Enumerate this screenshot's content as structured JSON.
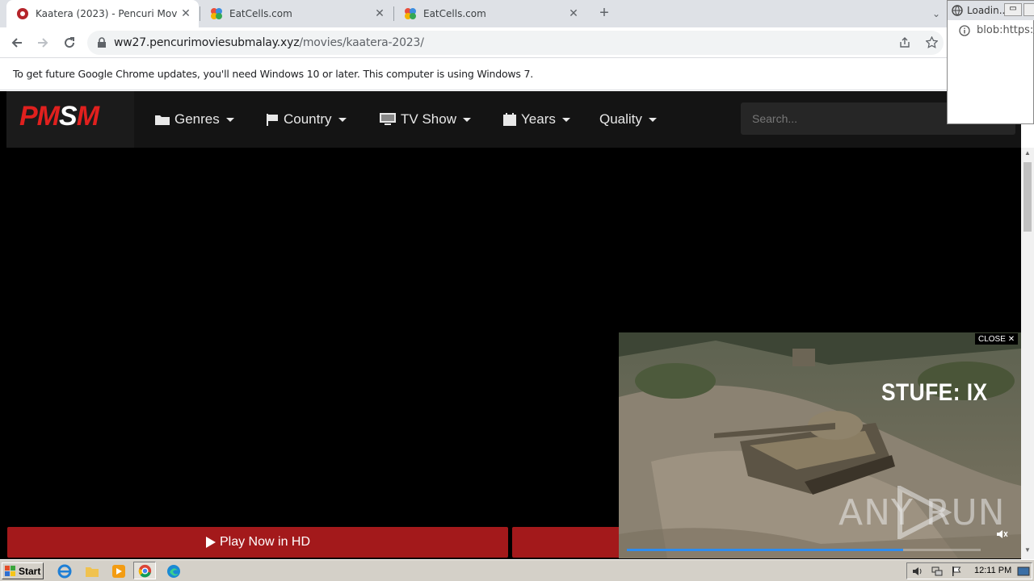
{
  "browser": {
    "tabs": [
      {
        "title": "Kaatera (2023) - Pencuri Movie Subl",
        "active": true
      },
      {
        "title": "EatCells.com",
        "active": false
      },
      {
        "title": "EatCells.com",
        "active": false
      }
    ],
    "new_tab_symbol": "+",
    "url_host": "ww27.pencurimoviesubmalay.xyz",
    "url_path": "/movies/kaatera-2023/",
    "infobar_text": "To get future Google Chrome updates, you'll need Windows 10 or later. This computer is using Windows 7."
  },
  "popup": {
    "title": "Loadin...",
    "address": "blob:https:/"
  },
  "site": {
    "logo": {
      "pm": "PM",
      "s": "S",
      "m": "M"
    },
    "nav": {
      "genres": "Genres",
      "country": "Country",
      "tv_show": "TV Show",
      "years": "Years",
      "quality": "Quality"
    },
    "search_placeholder": "Search...",
    "play_button": "Play Now in HD"
  },
  "ad": {
    "close_label": "CLOSE",
    "headline": "STUFE: IX",
    "watermark": "ANY RUN",
    "progress": 0.78
  },
  "taskbar": {
    "start_label": "Start",
    "clock": "12:11 PM"
  },
  "colors": {
    "brand_red": "#e0201e",
    "button_red": "#a3191b",
    "header_bg": "#141414"
  }
}
